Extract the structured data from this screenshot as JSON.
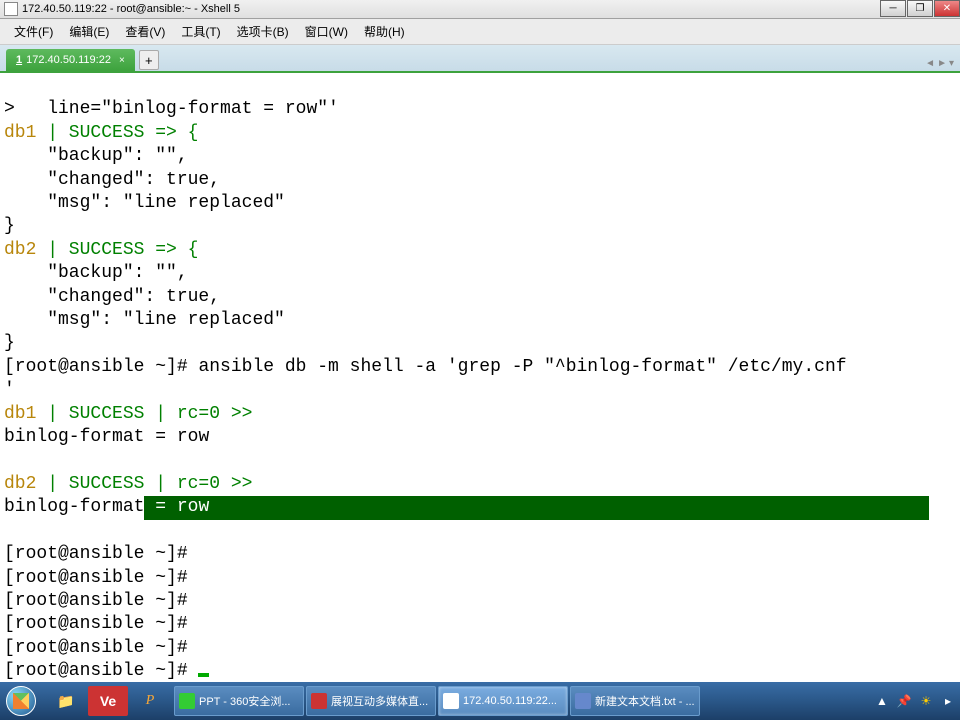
{
  "window": {
    "title": "172.40.50.119:22 - root@ansible:~ - Xshell 5"
  },
  "menu": {
    "file": "文件(F)",
    "edit": "编辑(E)",
    "view": "查看(V)",
    "tools": "工具(T)",
    "tabs": "选项卡(B)",
    "window": "窗口(W)",
    "help": "帮助(H)"
  },
  "tab": {
    "num": "1",
    "label": "172.40.50.119:22",
    "close": "×",
    "new": "+"
  },
  "terminal": {
    "line1_prefix": ">   line=\"binlog-format = row\"'",
    "db1": "db1",
    "success_arrow": " | SUCCESS => {",
    "backup": "    \"backup\": \"\",",
    "changed": "    \"changed\": true,",
    "msg": "    \"msg\": \"line replaced\"",
    "brace_close": "}",
    "db2": "db2",
    "prompt": "[root@ansible ~]# ",
    "cmd": "ansible db -m shell -a 'grep -P \"^binlog-format\" /etc/my.cnf",
    "cmd_cont": "'",
    "success_rc": " | SUCCESS | rc=0 >>",
    "binlog_line_pre": "binlog-format",
    "binlog_line_rest": " = row",
    "sel_text": " = row"
  },
  "taskbar": {
    "ve_icon": "Ve",
    "p_icon": "P",
    "items": [
      "PPT - 360安全浏...",
      "展视互动多媒体直...",
      "172.40.50.119:22...",
      "新建文本文档.txt - ..."
    ]
  }
}
